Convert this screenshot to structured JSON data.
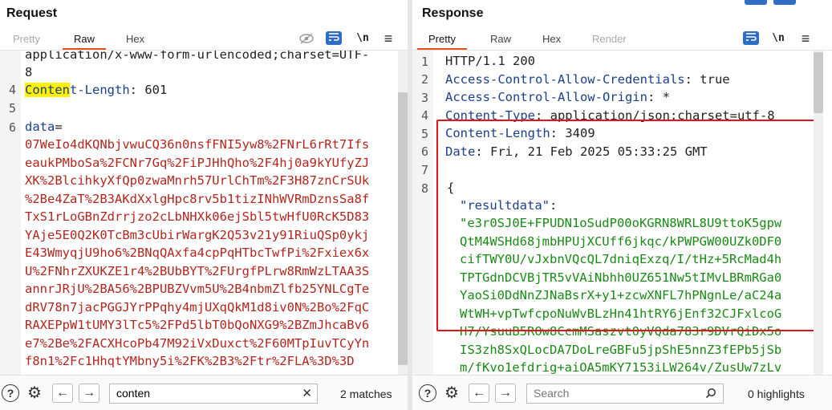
{
  "request": {
    "title": "Request",
    "tabs": [
      "Pretty",
      "Raw",
      "Hex"
    ],
    "active_tab": "Raw",
    "header_partial": "application/x-www-form-urlencoded;charset=UTF-",
    "header_partial_cont": "8",
    "line4_key_hl": "Conten",
    "line4_key_rest": "t-Length",
    "line4_value": ": 601",
    "line6_key": "data",
    "line6_eq": "=",
    "body_lines": [
      "07WeIo4dKQNbjvwuCQ36n0nsfFNI5yw8%2FNrL6rRt7Ifs",
      "eaukPMboSa%2FCNr7Gq%2FiPJHhQho%2F4hj0a9kYUfyZJ",
      "XK%2BlcihkyXfQp0zwaMnrh57UrlChTm%2F3H87znCrSUk",
      "%2Be4ZaT%2B3AKdXxlgHpc8rv5b1tizINhWVRmDznsSa8f",
      "TxS1rLoGBnZdrrjzo2cLbNHXk06ejSbl5twHfU0RcK5D83",
      "YAje5E0Q2K0TcBm3cUbirWargK2Q53v21y91RiuQSp0ykj",
      "E43WmyqjU9ho6%2BNqQAxfa4cpPqHTbcTwfPi%2Fxiex6x",
      "U%2FNhrZXUKZE1r4%2BUbBYT%2FUrgfPLrw8RmWzLTAA3S",
      "annrJRjU%2BA56%2BPUBZVvm5U%2B4nbmZlfb25YNLCgTe",
      "dRV78n7jacPGGJYrPPqhy4mjUXqQkM1d8iv0N%2Bo%2FqC",
      "RAXEPpW1tUMY3lTc5%2FPd5lbT0bQoNXG9%2BZmJhcaBv6",
      "e7%2Be%2FACXHcoPb47M92iVxDuxct%2F60MTpIuvTCyYn",
      "f8n1%2Fc1HhqtYMbny5i%2FK%2B3%2Ftr%2FLA%3D%3D"
    ],
    "line_numbers": [
      "4",
      "5",
      "6"
    ],
    "search_value": "conten",
    "match_count": "2 matches"
  },
  "response": {
    "title": "Response",
    "tabs": [
      "Pretty",
      "Raw",
      "Hex",
      "Render"
    ],
    "active_tab": "Pretty",
    "line_numbers": [
      "1",
      "2",
      "3",
      "4",
      "5",
      "6",
      "7",
      "8"
    ],
    "status_line": "HTTP/1.1 200",
    "headers": [
      {
        "key": "Access-Control-Allow-Credentials",
        "value": ": true"
      },
      {
        "key": "Access-Control-Allow-Origin",
        "value": ": *"
      },
      {
        "key": "Content-Type",
        "value": ": application/json;charset=utf-8"
      },
      {
        "key": "Content-Length",
        "value": ": 3409"
      },
      {
        "key": "Date",
        "value": ": Fri, 21 Feb 2025 05:33:25 GMT"
      }
    ],
    "brace_open": "{",
    "json_key": "\"resultdata\"",
    "json_colon": ":",
    "json_value_lines": [
      "\"e3r0SJ0E+FPUDN1oSudP00oKGRN8WRL8U9ttoK5gpw",
      "QtM4WSHd68jmbHPUjXCUff6jkqc/kPWPGW00UZk0DF0",
      "cifTWY0U/vJxbnVQcQL7dniqExzq/I/tHz+5RcMad4h",
      "TPTGdnDCVBjTR5vVAiNbhh0UZ651Nw5tIMvLBRmRGa0",
      "YaoSi0DdNnZJNaBsrX+y1+zcwXNFL7hPNgnLe/aC24a",
      "WtWH+vpTwfcpoNuWvBLzHn41htRY6jEnf32CJFxlcoG",
      "H7/YsuuB5ROw8CcmMSaszvt0yVQda783r9DVrQiDx5o",
      "IS3zh8SxQLocDA7DoLreGBFu5jpShE5nnZ3fEPb5jSb",
      "m/fKvo1efdrig+aiOA5mKY7153iLW264v/ZusUw7zLv"
    ],
    "search_placeholder": "Search",
    "highlight_count": "0 highlights"
  },
  "icons": {
    "eye_off": "eye-off-icon",
    "wrap": "wrap-icon",
    "newline": "\\n",
    "menu": "≡",
    "help": "?",
    "gear": "⚙",
    "arrow_left": "←",
    "arrow_right": "→",
    "clear": "✕"
  },
  "colors": {
    "accent_tab": "#e8501c",
    "button_blue": "#2f6cc4",
    "body_red": "#b3261e",
    "json_green": "#1a8a16",
    "header_blue": "#1d3f8a",
    "annotation_red": "#e3141b",
    "search_highlight": "#fff200"
  }
}
